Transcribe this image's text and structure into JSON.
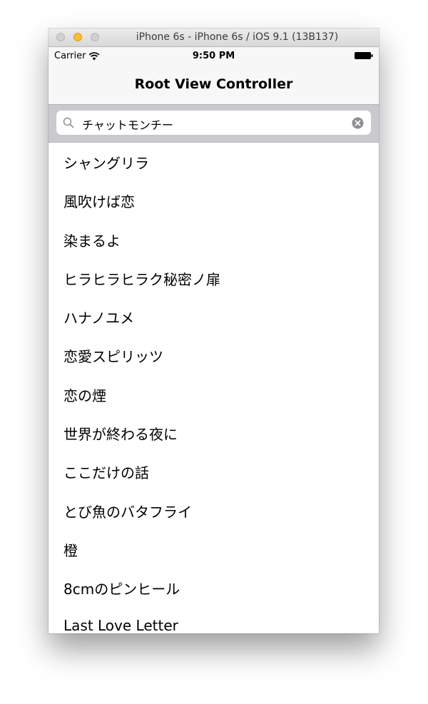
{
  "window": {
    "title": "iPhone 6s - iPhone 6s / iOS 9.1 (13B137)"
  },
  "status_bar": {
    "carrier": "Carrier",
    "time": "9:50 PM",
    "icons": [
      "wifi-icon",
      "battery-icon"
    ]
  },
  "nav_bar": {
    "title": "Root View Controller"
  },
  "search": {
    "text": "チャットモンチー",
    "icons": [
      "search-icon",
      "clear-icon"
    ]
  },
  "table": {
    "rows": [
      "シャングリラ",
      "風吹けば恋",
      "染まるよ",
      "ヒラヒラヒラク秘密ノ扉",
      "ハナノユメ",
      "恋愛スピリッツ",
      "恋の煙",
      "世界が終わる夜に",
      "ここだけの話",
      "とび魚のバタフライ",
      "橙",
      "8cmのピンヒール",
      "Last Love Letter"
    ]
  },
  "colors": {
    "traffic_minimize": "#fcbc2e",
    "search_background": "#c9c9ce",
    "bar_background": "#f7f7f7"
  }
}
